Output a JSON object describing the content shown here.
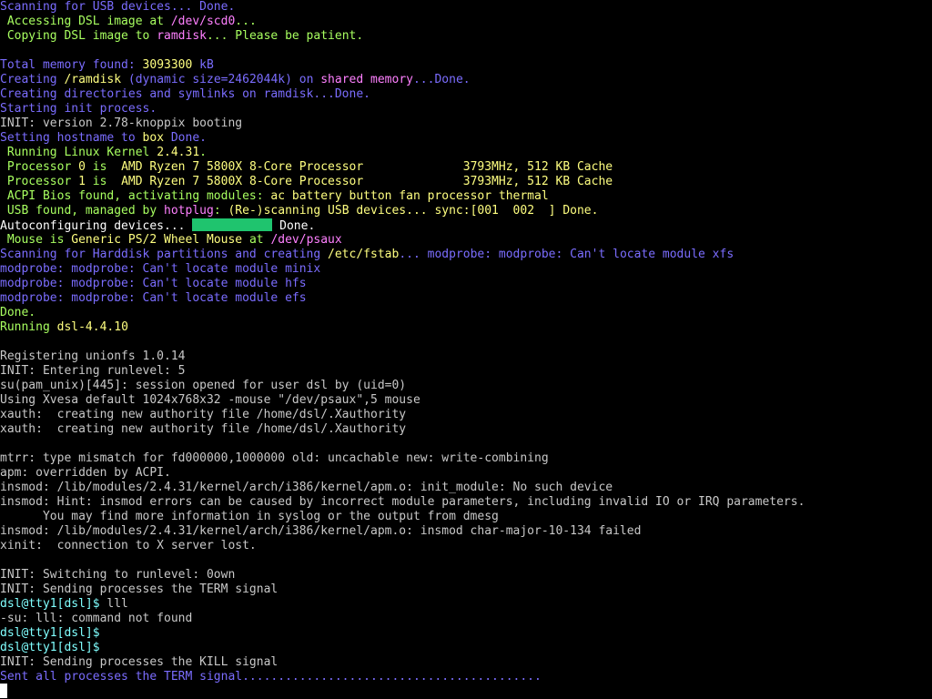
{
  "colors": {
    "default": "#c8c8c8",
    "blue": "#7b6dff",
    "green": "#a8ff60",
    "yellow": "#ffff80",
    "magenta": "#ff80ff",
    "cyan": "#80ffff",
    "white": "#ffffff",
    "progress_bar": "#1fc46e"
  },
  "terminal": {
    "lines": [
      [
        {
          "t": "Scanning for USB devices... Done.",
          "c": "blue"
        }
      ],
      [
        {
          "t": " Accessing DSL image at ",
          "c": "green"
        },
        {
          "t": "/dev/scd0",
          "c": "magenta"
        },
        {
          "t": "...",
          "c": "green"
        }
      ],
      [
        {
          "t": " Copying DSL image to ",
          "c": "green"
        },
        {
          "t": "ramdisk",
          "c": "magenta"
        },
        {
          "t": "... Please be patient.",
          "c": "green"
        }
      ],
      [],
      [
        {
          "t": "Total memory found: ",
          "c": "blue"
        },
        {
          "t": "3093300",
          "c": "yellow"
        },
        {
          "t": " kB",
          "c": "blue"
        }
      ],
      [
        {
          "t": "Creating ",
          "c": "blue"
        },
        {
          "t": "/ramdisk",
          "c": "yellow"
        },
        {
          "t": " (dynamic size=2462044k) on ",
          "c": "blue"
        },
        {
          "t": "shared memory",
          "c": "magenta"
        },
        {
          "t": "...Done.",
          "c": "blue"
        }
      ],
      [
        {
          "t": "Creating directories and symlinks on ramdisk...Done.",
          "c": "blue"
        }
      ],
      [
        {
          "t": "Starting init process.",
          "c": "blue"
        }
      ],
      [
        {
          "t": "INIT: version 2.78-knoppix booting",
          "c": "default"
        }
      ],
      [
        {
          "t": "Setting hostname to ",
          "c": "blue"
        },
        {
          "t": "box",
          "c": "yellow"
        },
        {
          "t": " Done.",
          "c": "blue"
        }
      ],
      [
        {
          "t": " Running Linux Kernel ",
          "c": "green"
        },
        {
          "t": "2.4.31",
          "c": "yellow"
        },
        {
          "t": ".",
          "c": "green"
        }
      ],
      [
        {
          "t": " Processor ",
          "c": "green"
        },
        {
          "t": "0",
          "c": "yellow"
        },
        {
          "t": " is  ",
          "c": "green"
        },
        {
          "t": "AMD Ryzen 7 5800X 8-Core Processor              3793MHz, 512 KB Cache",
          "c": "yellow"
        }
      ],
      [
        {
          "t": " Processor ",
          "c": "green"
        },
        {
          "t": "1",
          "c": "yellow"
        },
        {
          "t": " is  ",
          "c": "green"
        },
        {
          "t": "AMD Ryzen 7 5800X 8-Core Processor              3793MHz, 512 KB Cache",
          "c": "yellow"
        }
      ],
      [
        {
          "t": " ACPI Bios found, activating modules: ",
          "c": "green"
        },
        {
          "t": "ac battery button fan processor thermal",
          "c": "yellow"
        }
      ],
      [
        {
          "t": " USB found, managed by ",
          "c": "green"
        },
        {
          "t": "hotplug",
          "c": "magenta"
        },
        {
          "t": ": ",
          "c": "green"
        },
        {
          "t": "(Re-)scanning USB devices... sync:[001  002  ] Done.",
          "c": "yellow"
        }
      ],
      [
        {
          "t": "Autoconfiguring devices... ",
          "c": "white"
        },
        {
          "bar": true
        },
        {
          "t": " Done.",
          "c": "white"
        }
      ],
      [
        {
          "t": " Mouse is ",
          "c": "green"
        },
        {
          "t": "Generic PS/2 Wheel Mouse",
          "c": "yellow"
        },
        {
          "t": " at ",
          "c": "green"
        },
        {
          "t": "/dev/psaux",
          "c": "magenta"
        }
      ],
      [
        {
          "t": "Scanning for Harddisk partitions and creating ",
          "c": "blue"
        },
        {
          "t": "/etc/fstab",
          "c": "yellow"
        },
        {
          "t": "... modprobe: modprobe: Can't locate module xfs",
          "c": "blue"
        }
      ],
      [
        {
          "t": "modprobe: modprobe: Can't locate module minix",
          "c": "blue"
        }
      ],
      [
        {
          "t": "modprobe: modprobe: Can't locate module hfs",
          "c": "blue"
        }
      ],
      [
        {
          "t": "modprobe: modprobe: Can't locate module efs",
          "c": "blue"
        }
      ],
      [
        {
          "t": "Done.",
          "c": "green"
        }
      ],
      [
        {
          "t": "Running ",
          "c": "green"
        },
        {
          "t": "dsl-4.4.10",
          "c": "yellow"
        }
      ],
      [],
      [
        {
          "t": "Registering unionfs 1.0.14",
          "c": "default"
        }
      ],
      [
        {
          "t": "INIT: Entering runlevel: 5",
          "c": "default"
        }
      ],
      [
        {
          "t": "su(pam_unix)[445]: session opened for user dsl by (uid=0)",
          "c": "default"
        }
      ],
      [
        {
          "t": "Using Xvesa default 1024x768x32 -mouse \"/dev/psaux\",5 mouse",
          "c": "default"
        }
      ],
      [
        {
          "t": "xauth:  creating new authority file /home/dsl/.Xauthority",
          "c": "default"
        }
      ],
      [
        {
          "t": "xauth:  creating new authority file /home/dsl/.Xauthority",
          "c": "default"
        }
      ],
      [],
      [
        {
          "t": "mtrr: type mismatch for fd000000,1000000 old: uncachable new: write-combining",
          "c": "default"
        }
      ],
      [
        {
          "t": "apm: overridden by ACPI.",
          "c": "default"
        }
      ],
      [
        {
          "t": "insmod: /lib/modules/2.4.31/kernel/arch/i386/kernel/apm.o: init_module: No such device",
          "c": "default"
        }
      ],
      [
        {
          "t": "insmod: Hint: insmod errors can be caused by incorrect module parameters, including invalid IO or IRQ parameters.",
          "c": "default"
        }
      ],
      [
        {
          "t": "      You may find more information in syslog or the output from dmesg",
          "c": "default"
        }
      ],
      [
        {
          "t": "insmod: /lib/modules/2.4.31/kernel/arch/i386/kernel/apm.o: insmod char-major-10-134 failed",
          "c": "default"
        }
      ],
      [
        {
          "t": "xinit:  connection to X server lost.",
          "c": "default"
        }
      ],
      [],
      [
        {
          "t": "INIT: Switching to runlevel: 0own",
          "c": "default"
        }
      ],
      [
        {
          "t": "INIT: Sending processes the TERM signal",
          "c": "default"
        }
      ],
      [
        {
          "t": "dsl@tty1[dsl]$",
          "c": "cyan"
        },
        {
          "t": " lll",
          "c": "default"
        }
      ],
      [
        {
          "t": "-su: lll: command not found",
          "c": "default"
        }
      ],
      [
        {
          "t": "dsl@tty1[dsl]$",
          "c": "cyan"
        }
      ],
      [
        {
          "t": "dsl@tty1[dsl]$",
          "c": "cyan"
        }
      ],
      [
        {
          "t": "INIT: Sending processes the KILL signal",
          "c": "default"
        }
      ],
      [
        {
          "t": "Sent all processes the TERM signal..........................................",
          "c": "blue"
        }
      ]
    ]
  }
}
